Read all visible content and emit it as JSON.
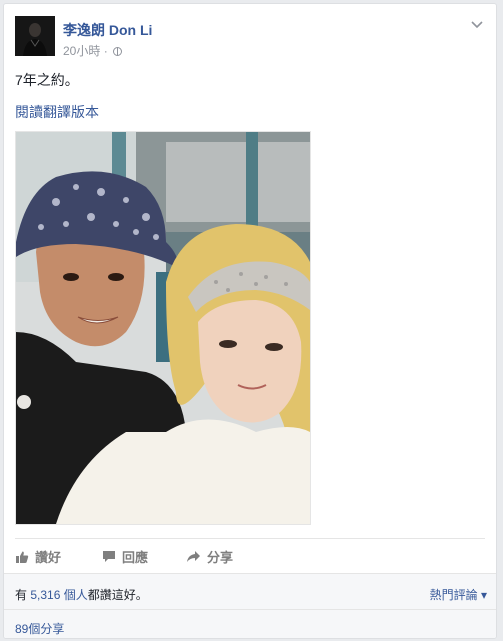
{
  "post": {
    "author": "李逸朗 Don Li",
    "time": "20小時",
    "separator": "·",
    "text": "7年之約。",
    "translate_link": "閱讀翻譯版本"
  },
  "actions": {
    "like": "讚好",
    "comment": "回應",
    "share": "分享"
  },
  "likes": {
    "prefix": "有",
    "count": "5,316",
    "people": "個人",
    "suffix": "都讚這好。"
  },
  "sort": {
    "label": "熱門評論",
    "arrow": "▾"
  },
  "shares": {
    "label": "89個分享"
  },
  "icons": {
    "chevron": "chevron-down-icon",
    "globe": "globe-icon",
    "like": "thumbs-up-icon",
    "comment": "comment-icon",
    "share": "share-arrow-icon"
  },
  "colors": {
    "link": "#365899",
    "muted": "#90949c",
    "action": "#7f7f7f",
    "background": "#e9ebee"
  }
}
